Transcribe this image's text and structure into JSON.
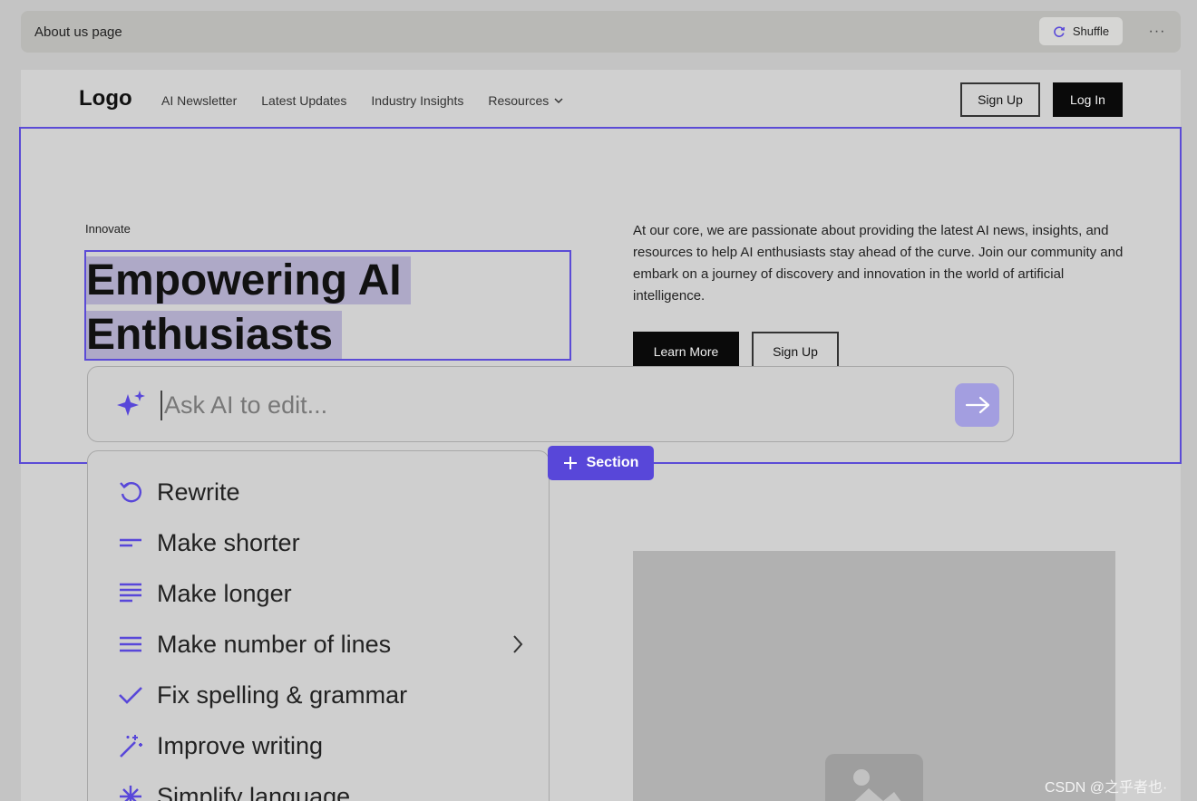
{
  "toolbar": {
    "page_name": "About us page",
    "shuffle_label": "Shuffle",
    "more_label": "···"
  },
  "nav": {
    "logo": "Logo",
    "links": [
      "AI Newsletter",
      "Latest Updates",
      "Industry Insights",
      "Resources"
    ],
    "signup_label": "Sign Up",
    "login_label": "Log In"
  },
  "hero": {
    "tagline": "Innovate",
    "heading_line1": "Empowering AI",
    "heading_line2": "Enthusiasts",
    "description": "At our core, we are passionate about providing the latest AI news, insights, and resources to help AI enthusiasts stay ahead of the curve. Join our community and embark on a journey of discovery and innovation in the world of artificial intelligence.",
    "primary_button": "Learn More",
    "secondary_button": "Sign Up"
  },
  "ai_prompt": {
    "placeholder": "Ask AI to edit..."
  },
  "section_button": {
    "label": "Section"
  },
  "ai_menu": {
    "items": [
      {
        "label": "Rewrite",
        "icon": "rewrite-icon"
      },
      {
        "label": "Make shorter",
        "icon": "short-lines-icon"
      },
      {
        "label": "Make longer",
        "icon": "long-lines-icon"
      },
      {
        "label": "Make number of lines",
        "icon": "lines-icon"
      },
      {
        "label": "Fix spelling & grammar",
        "icon": "check-icon"
      },
      {
        "label": "Improve writing",
        "icon": "magic-wand-icon"
      },
      {
        "label": "Simplify language",
        "icon": "sparkle-icon"
      }
    ]
  },
  "watermark": "CSDN @之乎者也·",
  "colors": {
    "accent": "#5847d9",
    "accent_light": "#a39ee0",
    "selection": "#aea9c7",
    "page_bg": "#d0d0d0"
  }
}
